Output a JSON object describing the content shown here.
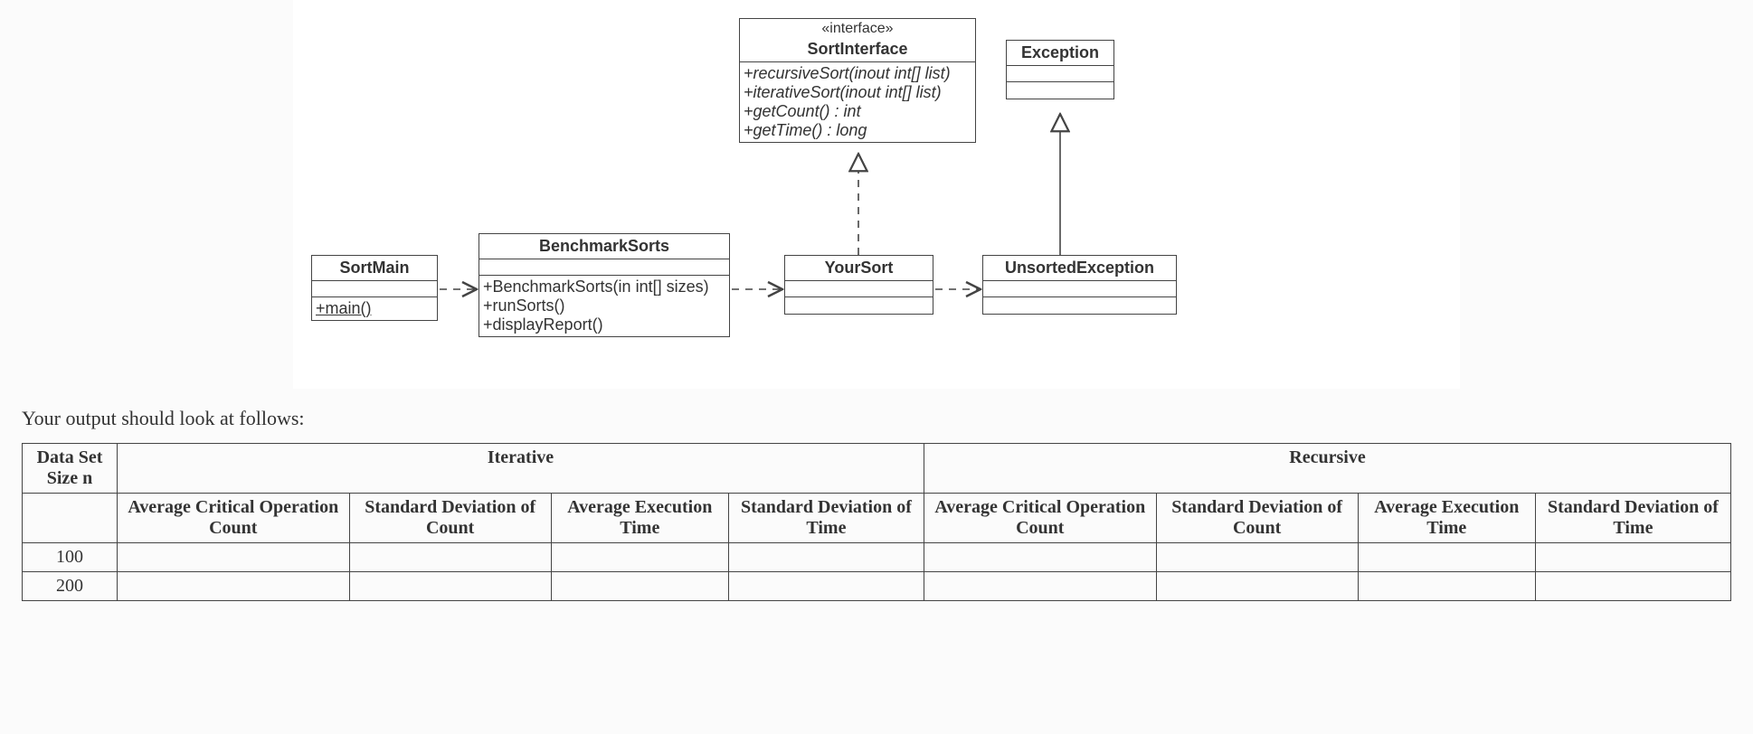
{
  "uml": {
    "sortinterface": {
      "stereotype": "«interface»",
      "name": "SortInterface",
      "operations": [
        "+recursiveSort(inout int[] list)",
        "+iterativeSort(inout int[] list)",
        "+getCount() : int",
        "+getTime() : long"
      ]
    },
    "exception": {
      "name": "Exception"
    },
    "sortmain": {
      "name": "SortMain",
      "operations": [
        "+main()"
      ]
    },
    "benchmark": {
      "name": "BenchmarkSorts",
      "operations": [
        "+BenchmarkSorts(in int[] sizes)",
        "+runSorts()",
        "+displayReport()"
      ]
    },
    "yoursort": {
      "name": "YourSort"
    },
    "unsorted": {
      "name": "UnsortedException"
    }
  },
  "caption": "Your output should look at follows:",
  "table": {
    "first_header": "Data Set Size n",
    "group_iterative": "Iterative",
    "group_recursive": "Recursive",
    "subheaders": [
      "Average Critical Operation Count",
      "Standard Deviation of Count",
      "Average Execution Time",
      "Standard Deviation of Time"
    ],
    "rows": [
      {
        "n": "100"
      },
      {
        "n": "200"
      }
    ]
  }
}
